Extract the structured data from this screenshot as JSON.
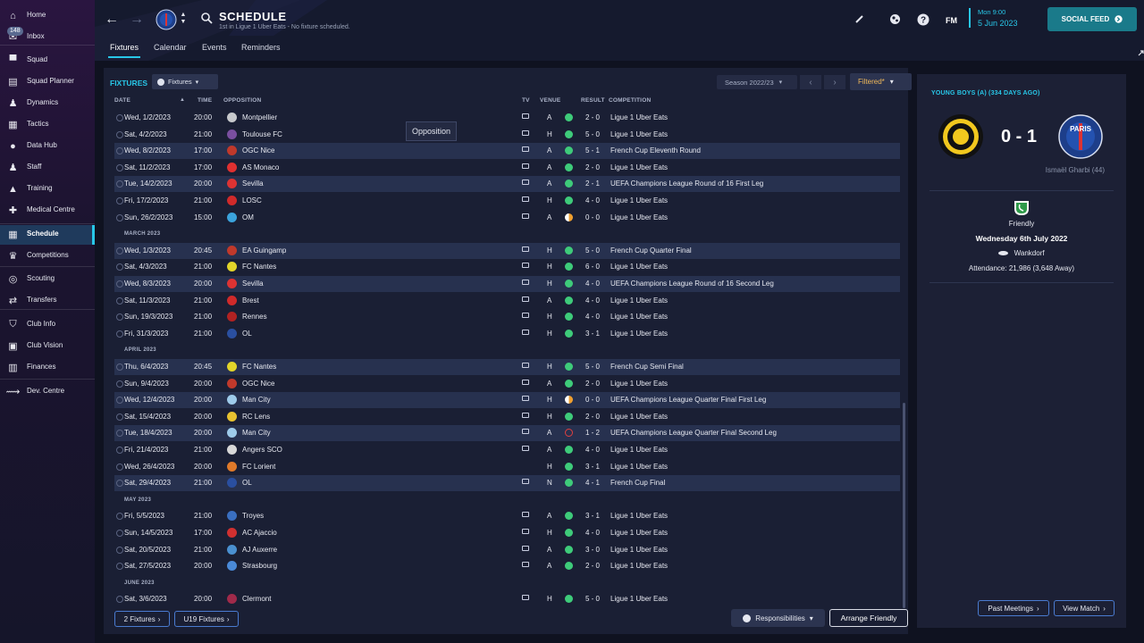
{
  "sidebar": {
    "inbox_badge": "148",
    "items": [
      {
        "label": "Home",
        "icon": "home-icon"
      },
      {
        "label": "Inbox",
        "icon": "inbox-icon"
      },
      {
        "label": "Squad",
        "icon": "shirt-icon"
      },
      {
        "label": "Squad Planner",
        "icon": "squad-planner-icon"
      },
      {
        "label": "Dynamics",
        "icon": "dynamics-icon"
      },
      {
        "label": "Tactics",
        "icon": "tactics-icon"
      },
      {
        "label": "Data Hub",
        "icon": "data-hub-icon"
      },
      {
        "label": "Staff",
        "icon": "staff-icon"
      },
      {
        "label": "Training",
        "icon": "training-icon"
      },
      {
        "label": "Medical Centre",
        "icon": "medical-icon"
      },
      {
        "label": "Schedule",
        "icon": "calendar-icon",
        "active": true
      },
      {
        "label": "Competitions",
        "icon": "trophy-icon"
      },
      {
        "label": "Scouting",
        "icon": "scouting-icon"
      },
      {
        "label": "Transfers",
        "icon": "transfers-icon"
      },
      {
        "label": "Club Info",
        "icon": "shield-icon"
      },
      {
        "label": "Club Vision",
        "icon": "vision-icon"
      },
      {
        "label": "Finances",
        "icon": "finances-icon"
      },
      {
        "label": "Dev. Centre",
        "icon": "dev-centre-icon"
      }
    ]
  },
  "header": {
    "title": "SCHEDULE",
    "subtitle": "1st in Ligue 1 Uber Eats - No fixture scheduled.",
    "tabs": [
      "Fixtures",
      "Calendar",
      "Events",
      "Reminders"
    ],
    "fm_label": "FM",
    "date_line1": "Mon 9:00",
    "date_line2": "5 Jun 2023",
    "social_feed": "SOCIAL FEED"
  },
  "fixtures": {
    "title": "FIXTURES",
    "dropdown": "Fixtures",
    "season": "Season 2022/23",
    "filtered": "Filtered*",
    "columns": {
      "date": "DATE",
      "time": "TIME",
      "opposition": "OPPOSITION",
      "tv": "TV",
      "venue": "VENUE",
      "result": "RESULT",
      "competition": "COMPETITION"
    },
    "tooltip": "Opposition",
    "months": [
      "MARCH 2023",
      "APRIL 2023",
      "MAY 2023",
      "JUNE 2023"
    ],
    "rows": [
      {
        "date": "Wed, 1/2/2023",
        "time": "20:00",
        "opp": "Montpellier",
        "tv": true,
        "venue": "A",
        "outcome": "win",
        "result": "2 - 0",
        "comp": "Ligue 1 Uber Eats",
        "crest": "#c7c9cc"
      },
      {
        "date": "Sat, 4/2/2023",
        "time": "21:00",
        "opp": "Toulouse FC",
        "tv": true,
        "venue": "H",
        "outcome": "win",
        "result": "5 - 0",
        "comp": "Ligue 1 Uber Eats",
        "crest": "#7a4fa0"
      },
      {
        "date": "Wed, 8/2/2023",
        "time": "17:00",
        "opp": "OGC Nice",
        "tv": true,
        "venue": "A",
        "outcome": "win",
        "result": "5 - 1",
        "comp": "French Cup Eleventh Round",
        "crest": "#c0392b"
      },
      {
        "date": "Sat, 11/2/2023",
        "time": "17:00",
        "opp": "AS Monaco",
        "tv": true,
        "venue": "A",
        "outcome": "win",
        "result": "2 - 0",
        "comp": "Ligue 1 Uber Eats",
        "crest": "#e03030"
      },
      {
        "date": "Tue, 14/2/2023",
        "time": "20:00",
        "opp": "Sevilla",
        "tv": true,
        "venue": "A",
        "outcome": "win",
        "result": "2 - 1",
        "comp": "UEFA Champions League Round of 16  First Leg",
        "crest": "#d33"
      },
      {
        "date": "Fri, 17/2/2023",
        "time": "21:00",
        "opp": "LOSC",
        "tv": true,
        "venue": "H",
        "outcome": "win",
        "result": "4 - 0",
        "comp": "Ligue 1 Uber Eats",
        "crest": "#d02a2a"
      },
      {
        "date": "Sun, 26/2/2023",
        "time": "15:00",
        "opp": "OM",
        "tv": true,
        "venue": "A",
        "outcome": "draw",
        "result": "0 - 0",
        "comp": "Ligue 1 Uber Eats",
        "crest": "#3ba3dc"
      },
      {
        "date": "Wed, 1/3/2023",
        "time": "20:45",
        "opp": "EA Guingamp",
        "tv": true,
        "venue": "H",
        "outcome": "win",
        "result": "5 - 0",
        "comp": "French Cup Quarter Final",
        "crest": "#c0392b"
      },
      {
        "date": "Sat, 4/3/2023",
        "time": "21:00",
        "opp": "FC Nantes",
        "tv": true,
        "venue": "H",
        "outcome": "win",
        "result": "6 - 0",
        "comp": "Ligue 1 Uber Eats",
        "crest": "#e2d52a"
      },
      {
        "date": "Wed, 8/3/2023",
        "time": "20:00",
        "opp": "Sevilla",
        "tv": true,
        "venue": "H",
        "outcome": "win",
        "result": "4 - 0",
        "comp": "UEFA Champions League Round of 16  Second Leg",
        "crest": "#d33"
      },
      {
        "date": "Sat, 11/3/2023",
        "time": "21:00",
        "opp": "Brest",
        "tv": true,
        "venue": "A",
        "outcome": "win",
        "result": "4 - 0",
        "comp": "Ligue 1 Uber Eats",
        "crest": "#d02a2a"
      },
      {
        "date": "Sun, 19/3/2023",
        "time": "21:00",
        "opp": "Rennes",
        "tv": true,
        "venue": "H",
        "outcome": "win",
        "result": "4 - 0",
        "comp": "Ligue 1 Uber Eats",
        "crest": "#b22222"
      },
      {
        "date": "Fri, 31/3/2023",
        "time": "21:00",
        "opp": "OL",
        "tv": true,
        "venue": "H",
        "outcome": "win",
        "result": "3 - 1",
        "comp": "Ligue 1 Uber Eats",
        "crest": "#2a4fa0"
      },
      {
        "date": "Thu, 6/4/2023",
        "time": "20:45",
        "opp": "FC Nantes",
        "tv": true,
        "venue": "H",
        "outcome": "win",
        "result": "5 - 0",
        "comp": "French Cup Semi Final",
        "crest": "#e2d52a"
      },
      {
        "date": "Sun, 9/4/2023",
        "time": "20:00",
        "opp": "OGC Nice",
        "tv": true,
        "venue": "A",
        "outcome": "win",
        "result": "2 - 0",
        "comp": "Ligue 1 Uber Eats",
        "crest": "#c0392b"
      },
      {
        "date": "Wed, 12/4/2023",
        "time": "20:00",
        "opp": "Man City",
        "tv": true,
        "venue": "H",
        "outcome": "draw",
        "result": "0 - 0",
        "comp": "UEFA Champions League Quarter Final First Leg",
        "crest": "#9ecbea"
      },
      {
        "date": "Sat, 15/4/2023",
        "time": "20:00",
        "opp": "RC Lens",
        "tv": true,
        "venue": "H",
        "outcome": "win",
        "result": "2 - 0",
        "comp": "Ligue 1 Uber Eats",
        "crest": "#e8c230"
      },
      {
        "date": "Tue, 18/4/2023",
        "time": "20:00",
        "opp": "Man City",
        "tv": true,
        "venue": "A",
        "outcome": "loss",
        "result": "1 - 2",
        "comp": "UEFA Champions League Quarter Final Second Leg",
        "crest": "#9ecbea"
      },
      {
        "date": "Fri, 21/4/2023",
        "time": "21:00",
        "opp": "Angers SCO",
        "tv": true,
        "venue": "A",
        "outcome": "win",
        "result": "4 - 0",
        "comp": "Ligue 1 Uber Eats",
        "crest": "#d8d8d8"
      },
      {
        "date": "Wed, 26/4/2023",
        "time": "20:00",
        "opp": "FC Lorient",
        "tv": false,
        "venue": "H",
        "outcome": "win",
        "result": "3 - 1",
        "comp": "Ligue 1 Uber Eats",
        "crest": "#e07a2a"
      },
      {
        "date": "Sat, 29/4/2023",
        "time": "21:00",
        "opp": "OL",
        "tv": true,
        "venue": "N",
        "outcome": "win",
        "result": "4 - 1",
        "comp": "French Cup Final",
        "crest": "#2a4fa0"
      },
      {
        "date": "Fri, 5/5/2023",
        "time": "21:00",
        "opp": "Troyes",
        "tv": true,
        "venue": "A",
        "outcome": "win",
        "result": "3 - 1",
        "comp": "Ligue 1 Uber Eats",
        "crest": "#3a6fc0"
      },
      {
        "date": "Sun, 14/5/2023",
        "time": "17:00",
        "opp": "AC Ajaccio",
        "tv": true,
        "venue": "H",
        "outcome": "win",
        "result": "4 - 0",
        "comp": "Ligue 1 Uber Eats",
        "crest": "#d03030"
      },
      {
        "date": "Sat, 20/5/2023",
        "time": "21:00",
        "opp": "AJ Auxerre",
        "tv": true,
        "venue": "A",
        "outcome": "win",
        "result": "3 - 0",
        "comp": "Ligue 1 Uber Eats",
        "crest": "#4a90d0"
      },
      {
        "date": "Sat, 27/5/2023",
        "time": "20:00",
        "opp": "Strasbourg",
        "tv": true,
        "venue": "A",
        "outcome": "win",
        "result": "2 - 0",
        "comp": "Ligue 1 Uber Eats",
        "crest": "#4a8ad8"
      },
      {
        "date": "Sat, 3/6/2023",
        "time": "20:00",
        "opp": "Clermont",
        "tv": true,
        "venue": "H",
        "outcome": "win",
        "result": "5 - 0",
        "comp": "Ligue 1 Uber Eats",
        "crest": "#a02a4a"
      }
    ],
    "btn_2_fixtures": "2 Fixtures",
    "btn_u19": "U19 Fixtures",
    "btn_responsibilities": "Responsibilities",
    "btn_arrange": "Arrange Friendly"
  },
  "match_panel": {
    "header": "YOUNG BOYS (A) (334 DAYS AGO)",
    "score": "0 - 1",
    "scorer": "Ismaël Gharbi (44)",
    "home_crest_text": "",
    "away_crest_text": "PARIS",
    "competition": "Friendly",
    "match_date": "Wednesday 6th July 2022",
    "stadium": "Wankdorf",
    "attendance": "Attendance: 21,986 (3,648 Away)",
    "btn_past": "Past Meetings",
    "btn_view": "View Match"
  },
  "colors": {
    "accent": "#28c7e8",
    "win": "#3ecb7a",
    "draw": "#f0a030",
    "loss": "#e04040",
    "filtered": "#f0b95a"
  }
}
